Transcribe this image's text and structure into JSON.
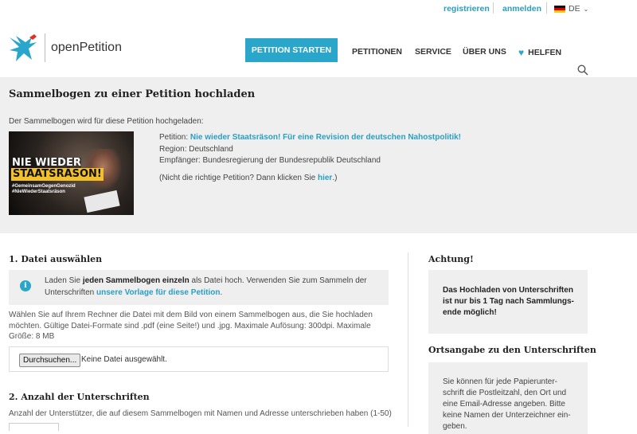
{
  "topbar": {
    "register": "registrieren",
    "login": "anmelden",
    "language": "DE"
  },
  "header": {
    "brand": "openPetition",
    "start_button": "PETITION STARTEN",
    "nav": {
      "petitions": "PETITIONEN",
      "service": "SERVICE",
      "about": "ÜBER UNS",
      "help": "HELFEN"
    }
  },
  "upload": {
    "title": "Sammelbogen zu einer Petition hochladen",
    "intro": "Der Sammelbogen wird für diese Petition hochgeladen:",
    "image_text": {
      "line1": "NIE WIEDER",
      "line2": "STAATSRÄSON!",
      "hashtag1": "#GemeinsamGegenGenozid",
      "hashtag2": "#NieWiederStaatsräson"
    },
    "petition_label": "Petition: ",
    "petition_title": "Nie wieder Staatsräson! Für eine Revision der deutschen Nahostpolitik!",
    "region": "Region: Deutschland",
    "recipient": "Empfänger: Bundesregierung der Bundesrepublik Deutschland",
    "wrong_prefix": "(Nicht die richtige Petition? Dann klicken Sie ",
    "wrong_link": "hier",
    "wrong_suffix": ".)"
  },
  "step1": {
    "heading": "1. Datei auswählen",
    "alert_pre": "Laden Sie ",
    "alert_bold": "jeden Sammelbogen einzeln",
    "alert_mid": " als Datei hoch. Verwenden Sie zum Sammeln der Unterschriften ",
    "alert_link": "unsere Vorlage für diese Petition",
    "alert_post": ".",
    "hint": "Wählen Sie auf Ihrem Rechner die Datei mit dem Bild von einem Sammelbogen aus, die Sie hochladen möchten. Gültige Datei-Formate sind .pdf (eine Seite!) und .jpg. Maximale Aufösung: 300dpi. Maximale Größe: 8 MB",
    "browse_button": "Durchsuchen...",
    "no_file": "Keine Datei ausgewählt."
  },
  "step2": {
    "heading": "2. Anzahl der Unterschriften",
    "hint": "Anzahl der Unterstützer, die auf diesem Sammelbogen mit Namen und Adresse unterschrieben haben (1-50)"
  },
  "sidebar": {
    "warning_heading": "Achtung!",
    "warning_text": "Das Hochladen von Unterschriften ist nur bis 1 Tag nach Sammlungs-ende möglich!",
    "location_heading": "Ortsangabe zu den Unterschriften",
    "location_text": "Sie können für jede Papierunter-schrift die Postleitzahl, den Ort und eine Email-Adresse angeben. Bitte keine Namen der Unterzeichner ein-geben."
  },
  "colors": {
    "accent": "#29a6c9",
    "panel": "#efefef"
  }
}
